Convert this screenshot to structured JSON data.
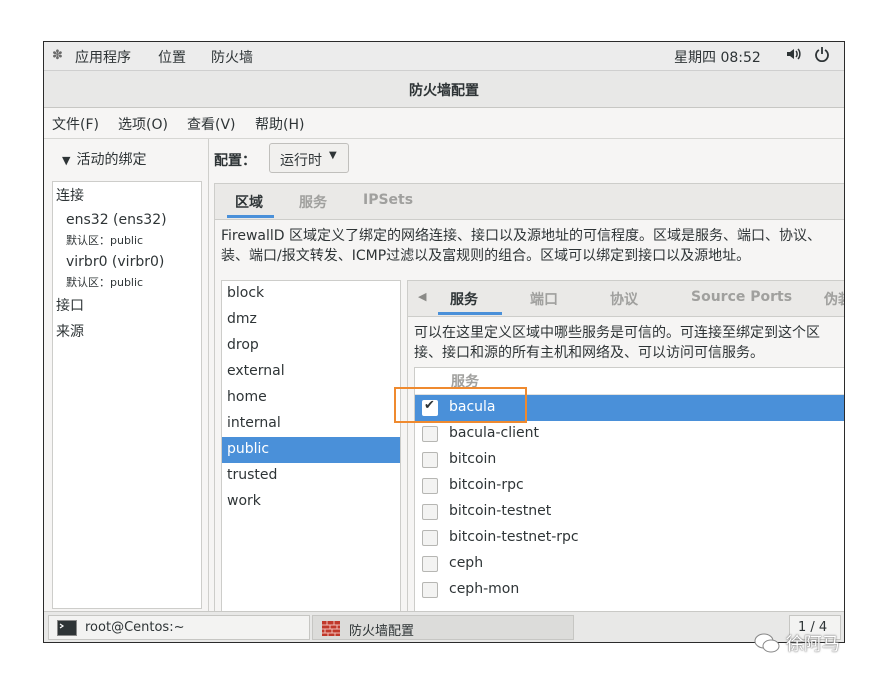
{
  "top_panel": {
    "applications": "应用程序",
    "places": "位置",
    "firewall": "防火墙",
    "clock": "星期四 08:52"
  },
  "window": {
    "title": "防火墙配置"
  },
  "menubar": [
    "文件(F)",
    "选项(O)",
    "查看(V)",
    "帮助(H)"
  ],
  "left": {
    "header": "活动的绑定",
    "connections_label": "连接",
    "connections": [
      {
        "name": "ens32 (ens32)",
        "zone": "默认区：public"
      },
      {
        "name": "virbr0 (virbr0)",
        "zone": "默认区：public"
      }
    ],
    "interfaces_label": "接口",
    "sources_label": "来源"
  },
  "config": {
    "label": "配置：",
    "mode": "运行时"
  },
  "main_tabs": [
    "区域",
    "服务",
    "IPSets"
  ],
  "zone_description": [
    "FirewallD 区域定义了绑定的网络连接、接口以及源地址的可信程度。区域是服务、端口、协议、",
    "装、端口/报文转发、ICMP过滤以及富规则的组合。区域可以绑定到接口以及源地址。"
  ],
  "zones": [
    "block",
    "dmz",
    "drop",
    "external",
    "home",
    "internal",
    "public",
    "trusted",
    "work"
  ],
  "selected_zone": "public",
  "zone_tabs": [
    "服务",
    "端口",
    "协议",
    "Source Ports",
    "伪装"
  ],
  "service_description": [
    "可以在这里定义区域中哪些服务是可信的。可连接至绑定到这个区",
    "接、接口和源的所有主机和网络及、可以访问可信服务。"
  ],
  "service_header": "服务",
  "services": [
    {
      "name": "bacula",
      "checked": true
    },
    {
      "name": "bacula-client",
      "checked": false
    },
    {
      "name": "bitcoin",
      "checked": false
    },
    {
      "name": "bitcoin-rpc",
      "checked": false
    },
    {
      "name": "bitcoin-testnet",
      "checked": false
    },
    {
      "name": "bitcoin-testnet-rpc",
      "checked": false
    },
    {
      "name": "ceph",
      "checked": false
    },
    {
      "name": "ceph-mon",
      "checked": false
    }
  ],
  "taskbar": {
    "terminal": "root@Centos:~",
    "firewall_config": "防火墙配置",
    "pager": "1 / 4"
  },
  "watermark": "徐阿马",
  "colors": {
    "selection": "#4a90d9",
    "annotation": "#ef8a2f"
  }
}
